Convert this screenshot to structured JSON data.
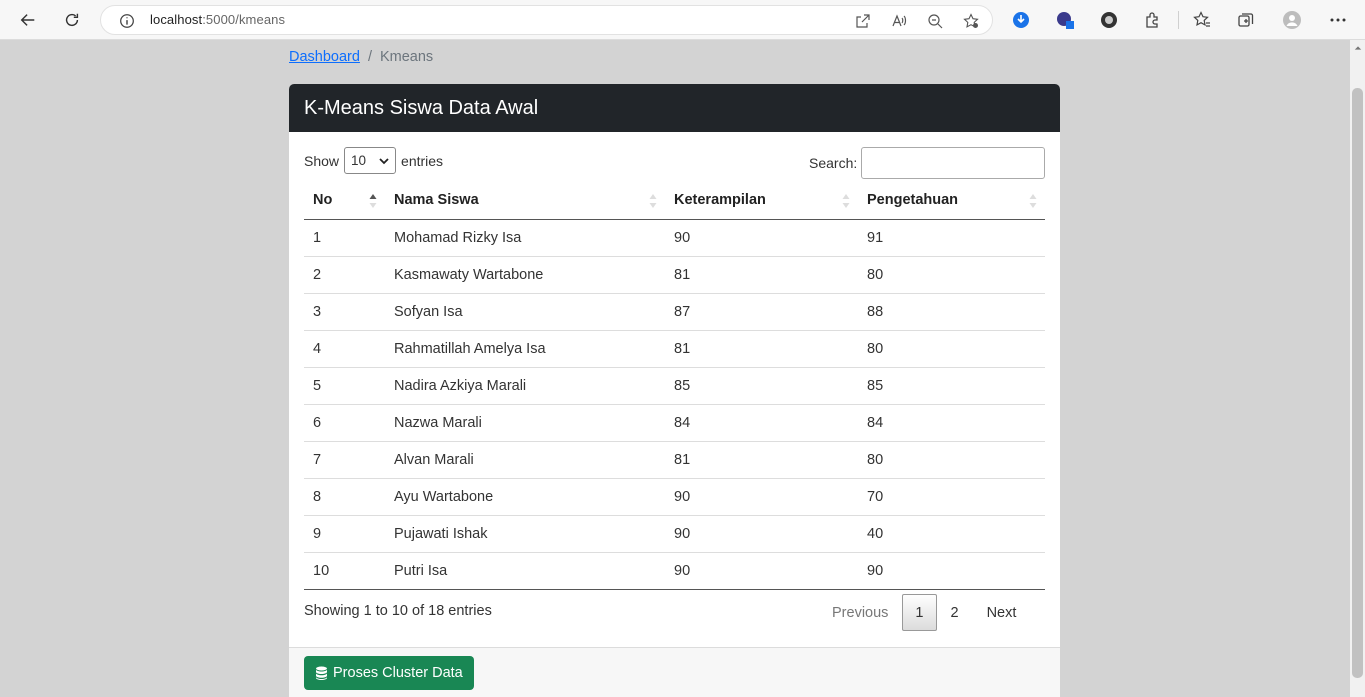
{
  "browser": {
    "url_host": "localhost",
    "url_path": ":5000/kmeans"
  },
  "breadcrumb": {
    "link": "Dashboard",
    "separator": "/",
    "current": "Kmeans"
  },
  "card": {
    "title": "K-Means Siswa Data Awal"
  },
  "length": {
    "show_label": "Show",
    "selected": "10",
    "entries_label": "entries"
  },
  "search": {
    "label": "Search:",
    "value": ""
  },
  "table": {
    "headers": [
      "No",
      "Nama Siswa",
      "Keterampilan",
      "Pengetahuan"
    ],
    "rows": [
      [
        "1",
        "Mohamad Rizky Isa",
        "90",
        "91"
      ],
      [
        "2",
        "Kasmawaty Wartabone",
        "81",
        "80"
      ],
      [
        "3",
        "Sofyan Isa",
        "87",
        "88"
      ],
      [
        "4",
        "Rahmatillah Amelya Isa",
        "81",
        "80"
      ],
      [
        "5",
        "Nadira Azkiya Marali",
        "85",
        "85"
      ],
      [
        "6",
        "Nazwa Marali",
        "84",
        "84"
      ],
      [
        "7",
        "Alvan Marali",
        "81",
        "80"
      ],
      [
        "8",
        "Ayu Wartabone",
        "90",
        "70"
      ],
      [
        "9",
        "Pujawati Ishak",
        "90",
        "40"
      ],
      [
        "10",
        "Putri Isa",
        "90",
        "90"
      ]
    ]
  },
  "info": "Showing 1 to 10 of 18 entries",
  "pagination": {
    "previous": "Previous",
    "pages": [
      "1",
      "2"
    ],
    "active_page": "1",
    "next": "Next"
  },
  "footer": {
    "button_label": "Proses Cluster Data"
  },
  "colors": {
    "header_bg": "#212529",
    "button_bg": "#198754",
    "link": "#0d6efd",
    "page_bg": "#d3d3d3"
  }
}
